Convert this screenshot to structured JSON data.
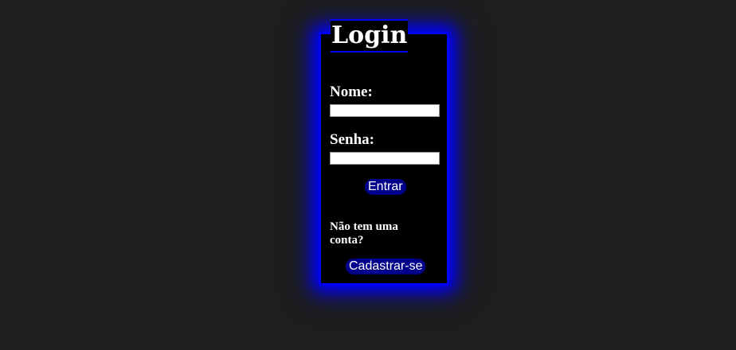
{
  "login": {
    "title": "Login",
    "name_label": "Nome:",
    "name_value": "",
    "password_label": "Senha:",
    "password_value": "",
    "submit_label": "Entrar",
    "no_account_text": "Não tem uma conta?",
    "register_label": "Cadastrar-se"
  },
  "colors": {
    "page_background": "#1e1e1e",
    "card_background": "#000000",
    "accent": "#0000ff",
    "button_background": "#00008b",
    "text": "#ffffff"
  }
}
